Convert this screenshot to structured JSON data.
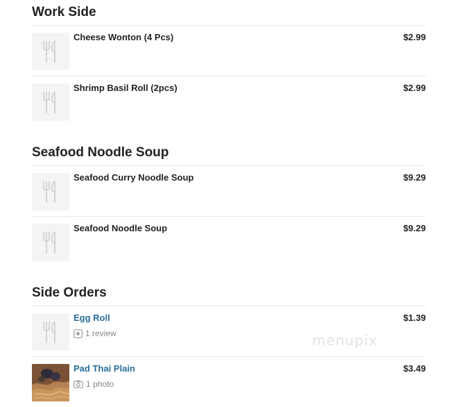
{
  "sections": [
    {
      "title": "Work Side",
      "items": [
        {
          "name": "Cheese Wonton (4 Pcs)",
          "price": "$2.99"
        },
        {
          "name": "Shrimp Basil Roll (2pcs)",
          "price": "$2.99"
        }
      ]
    },
    {
      "title": "Seafood Noodle Soup",
      "items": [
        {
          "name": "Seafood Curry Noodle Soup",
          "price": "$9.29"
        },
        {
          "name": "Seafood Noodle Soup",
          "price": "$9.29"
        }
      ]
    },
    {
      "title": "Side Orders",
      "items": [
        {
          "name": "Egg Roll",
          "price": "$1.39",
          "meta": "1 review",
          "meta_icon": "review-star-icon"
        },
        {
          "name": "Pad Thai Plain",
          "price": "$3.49",
          "meta": "1 photo",
          "meta_icon": "camera-icon"
        }
      ]
    }
  ],
  "watermark": "menupix",
  "colors": {
    "link": "#2a6e9c",
    "text": "#222222",
    "muted": "#888888",
    "divider": "#e6e6e6",
    "placeholder_bg": "#f4f4f4"
  },
  "icons": {
    "placeholder": "fork-knife-icon"
  }
}
